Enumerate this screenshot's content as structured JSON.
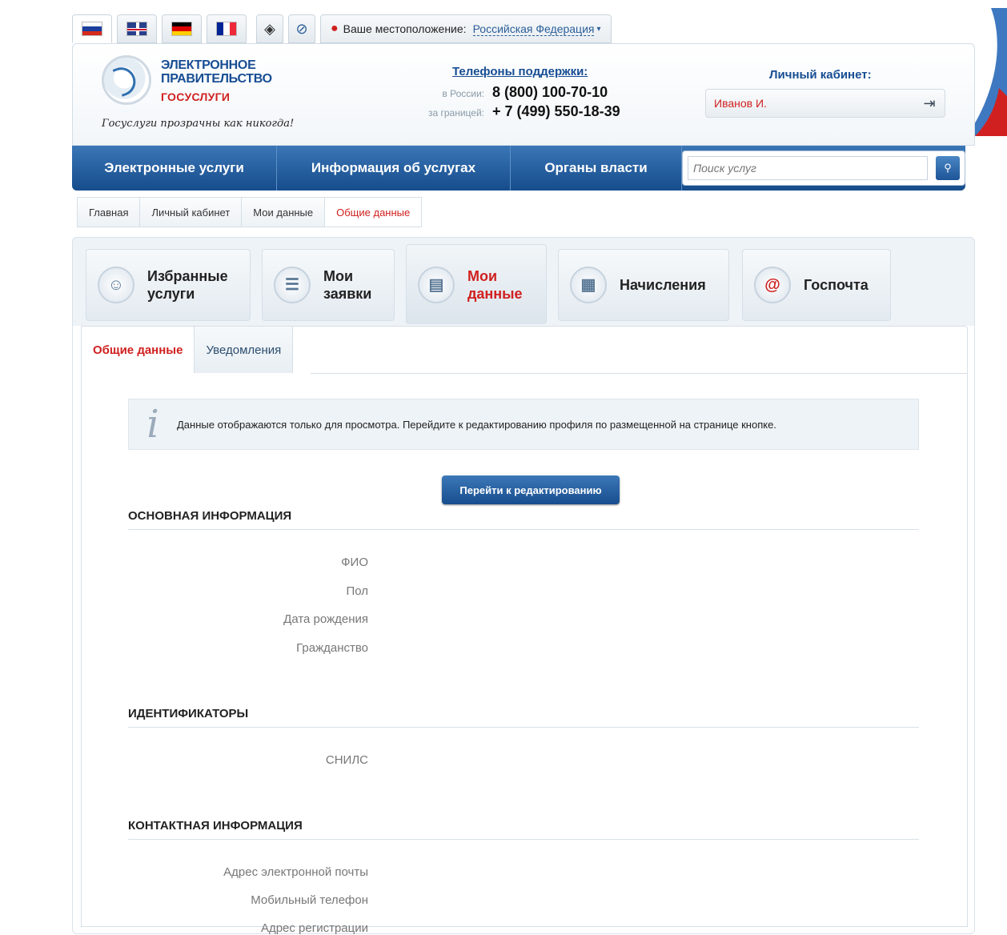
{
  "languages": [
    {
      "code": "ru",
      "colors": [
        "#ffffff",
        "#1c3f9e",
        "#d52b1e"
      ],
      "active": true
    },
    {
      "code": "en",
      "colors": [
        "#27408b",
        "#ffffff",
        "#cf142b"
      ],
      "active": false
    },
    {
      "code": "de",
      "colors": [
        "#000000",
        "#dd0000",
        "#ffce00"
      ],
      "active": false
    },
    {
      "code": "fr",
      "colors": [
        "#002395",
        "#ffffff",
        "#ed2939"
      ],
      "active": false
    }
  ],
  "topbar": {
    "accessibility_icon": "eye-icon",
    "compass_icon": "compass-icon",
    "location_label": "Ваше местоположение:",
    "location_value": "Российская Федерация"
  },
  "header": {
    "brand_line1": "ЭЛЕКТРОННОЕ",
    "brand_line2": "ПРАВИТЕЛЬСТВО",
    "brand_sub": "ГОСУСЛУГИ",
    "slogan": "Госуслуги прозрачны как никогда!",
    "support_title": "Телефоны поддержки:",
    "phones": [
      {
        "label": "в России:",
        "number": "8 (800) 100-70-10"
      },
      {
        "label": "за границей:",
        "number": "+ 7 (499) 550-18-39"
      }
    ],
    "cabinet_title": "Личный кабинет:",
    "cabinet_user": "Иванов И."
  },
  "nav": {
    "items": [
      "Электронные услуги",
      "Информация об услугах",
      "Органы власти"
    ],
    "search_placeholder": "Поиск услуг"
  },
  "breadcrumbs": [
    "Главная",
    "Личный кабинет",
    "Мои данные",
    "Общие данные"
  ],
  "tiles": [
    {
      "line1": "Избранные",
      "line2": "услуги",
      "icon": "user-star-icon"
    },
    {
      "line1": "Мои",
      "line2": "заявки",
      "icon": "list-icon"
    },
    {
      "line1": "Мои",
      "line2": "данные",
      "icon": "document-icon"
    },
    {
      "line1": "Начисления",
      "line2": "",
      "icon": "calculator-icon"
    },
    {
      "line1": "Госпочта",
      "line2": "",
      "icon": "at-icon"
    }
  ],
  "subtabs": [
    "Общие данные",
    "Уведомления"
  ],
  "info_text": "Данные отображаются только для просмотра. Перейдите к редактированию профиля по размещенной на странице кнопке.",
  "edit_button": "Перейти к редактированию",
  "sections": {
    "main": {
      "title": "ОСНОВНАЯ ИНФОРМАЦИЯ",
      "fields": [
        "ФИО",
        "Пол",
        "Дата рождения",
        "Гражданство"
      ]
    },
    "ids": {
      "title": "ИДЕНТИФИКАТОРЫ",
      "fields": [
        "СНИЛС"
      ]
    },
    "contacts": {
      "title": "КОНТАКТНАЯ ИНФОРМАЦИЯ",
      "fields": [
        "Адрес электронной почты",
        "Мобильный телефон",
        "Адрес регистрации"
      ]
    }
  },
  "colors": {
    "brand_blue": "#174d93",
    "accent_red": "#d0201f",
    "nav_blue": "#2a64a6"
  }
}
